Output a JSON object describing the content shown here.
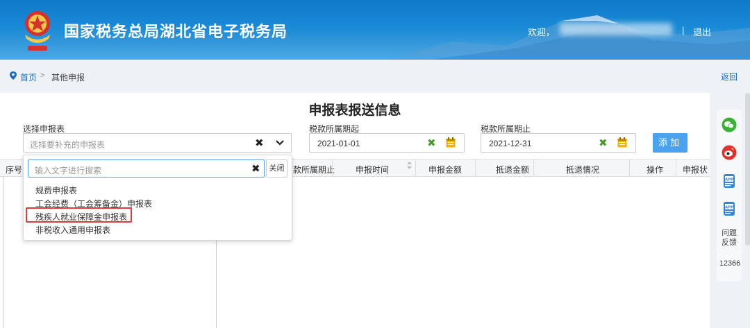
{
  "header": {
    "site_title": "国家税务总局湖北省电子税务局",
    "welcome_label": "欢迎，",
    "divider": "|",
    "logout_label": "退出"
  },
  "breadcrumb": {
    "home": "首页",
    "separator": ">",
    "current": "其他申报",
    "back": "返回"
  },
  "panel": {
    "title": "申报表报送信息"
  },
  "form": {
    "select_label": "选择申报表",
    "select_placeholder": "选择要补充的申报表",
    "clear_glyph": "✖",
    "period_start_label": "税款所属期起",
    "period_start_value": "2021-01-01",
    "period_end_label": "税款所属期止",
    "period_end_value": "2021-12-31",
    "add_button": "添加"
  },
  "table": {
    "headers": [
      "序号",
      "款所属期止",
      "申报时间",
      "申报金额",
      "抵退金额",
      "抵退情况",
      "操作",
      "申报状"
    ]
  },
  "dropdown": {
    "search_placeholder": "输入文字进行搜索",
    "close_label": "关闭",
    "options": [
      "规费申报表",
      "工会经费（工会筹备金）申报表",
      "残疾人就业保障金申报表",
      "非税收入通用申报表"
    ],
    "highlighted_index": 2
  },
  "sidebar": {
    "items": [
      {
        "icon": "wechat-icon",
        "color": "#3cb034"
      },
      {
        "icon": "weibo-icon",
        "color": "#e0302c"
      },
      {
        "icon": "app-icon",
        "label": "APP",
        "color": "#2f86d8"
      },
      {
        "icon": "app-icon",
        "label": "APP",
        "color": "#2f86d8"
      }
    ],
    "feedback": "问题反馈",
    "hotline": "12366"
  },
  "colors": {
    "header_blue": "#1a8ad6",
    "link_blue": "#1a6dc2",
    "button_blue": "#4aa3ec",
    "highlight_red": "#e33a3a",
    "clear_green": "#4a9a2e",
    "calendar_yellow": "#f0b400"
  }
}
